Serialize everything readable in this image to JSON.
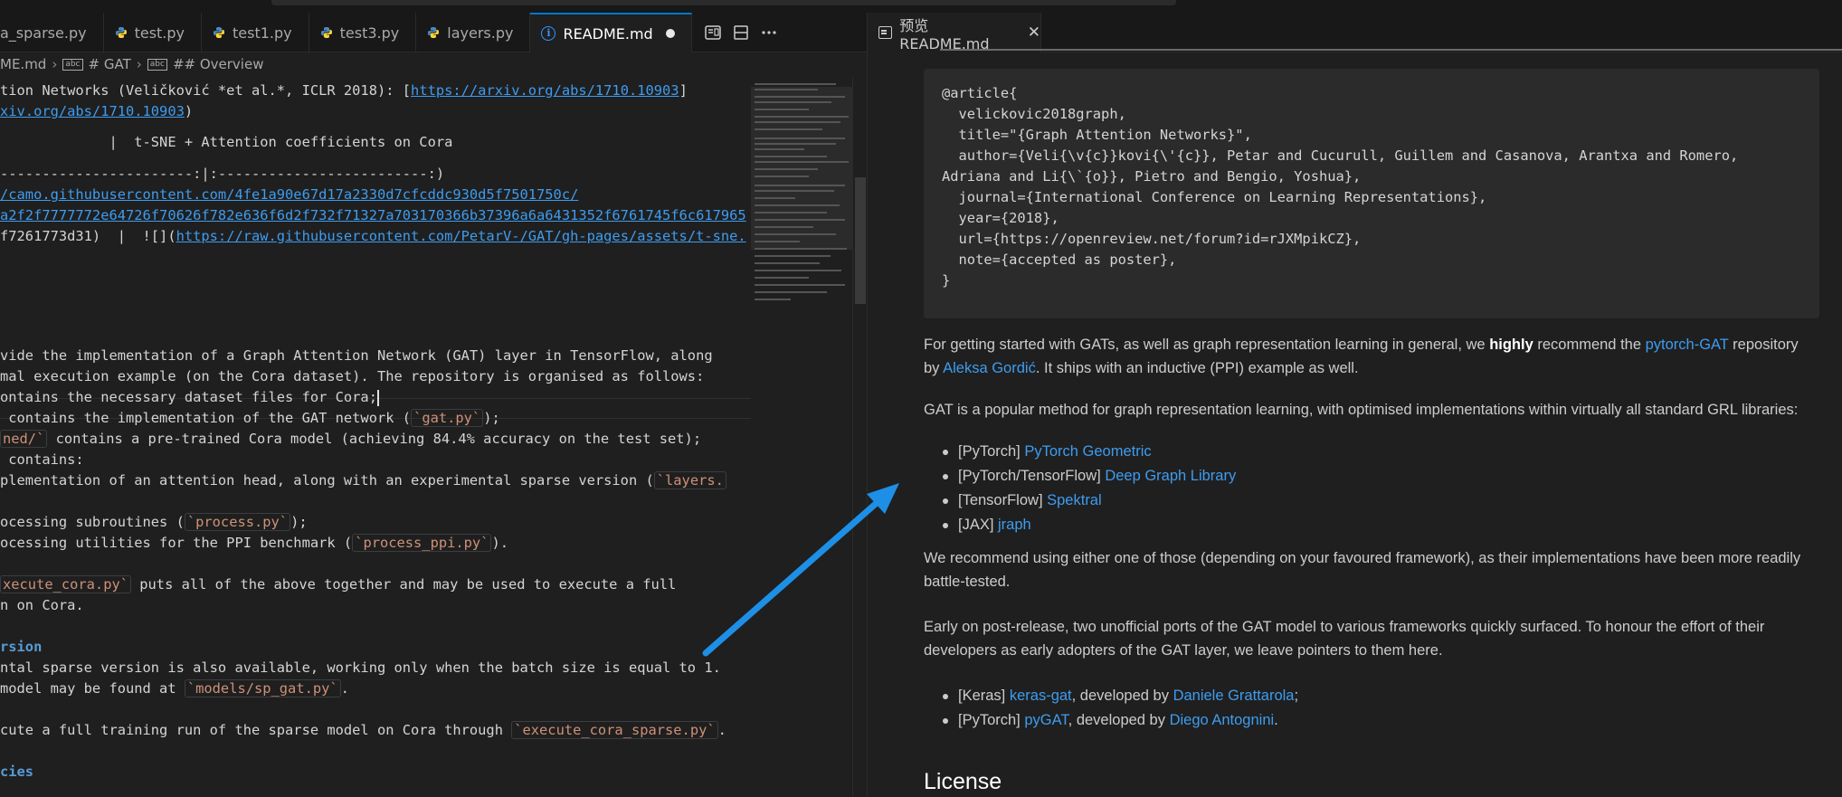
{
  "tabs": [
    {
      "label": "a_sparse.py",
      "icon": "python-icon"
    },
    {
      "label": "test.py",
      "icon": "python-icon"
    },
    {
      "label": "test1.py",
      "icon": "python-icon"
    },
    {
      "label": "test3.py",
      "icon": "python-icon"
    },
    {
      "label": "layers.py",
      "icon": "python-icon"
    },
    {
      "label": "README.md",
      "icon": "info-icon",
      "active": true,
      "dirty": true
    }
  ],
  "breadcrumb": {
    "file": "ME.md",
    "h1": "# GAT",
    "h2": "## Overview"
  },
  "editor_lines": {
    "l1a": "tion Networks (Veličković *et al.*, ICLR 2018): [",
    "l1link": "https://arxiv.org/abs/1710.10903",
    "l1b": "]",
    "l2link": "xiv.org/abs/1710.10903",
    "l2b": ")",
    "l3": "             |  t-SNE + Attention coefficients on Cora",
    "l4": "-----------------------:|:-------------------------:)",
    "l5": "/camo.githubusercontent.com/4fe1a90e67d17a2330d7cfcddc930d5f7501750c/",
    "l6": "a2f2f7777772e64726f70626f782e636f6d2f732f71327a703170366b37396a6a6431352f6761745f6c617965",
    "l7a": "f7261773d31)  |  ![](",
    "l7link": "https://raw.githubusercontent.com/PetarV-/GAT/gh-pages/assets/t-sne.",
    "l8": "vide the implementation of a Graph Attention Network (GAT) layer in TensorFlow, along",
    "l9": "mal execution example (on the Cora dataset). The repository is organised as follows:",
    "l10": "ontains the necessary dataset files for Cora;",
    "l11a": " contains the implementation of the GAT network (",
    "l11code": "`gat.py`",
    "l11b": ");",
    "l12code": "ned/`",
    "l12b": " contains a pre-trained Cora model (achieving 84.4% accuracy on the test set);",
    "l13": " contains:",
    "l14a": "plementation of an attention head, along with an experimental sparse version (",
    "l14code": "`layers.",
    "l15a": "ocessing subroutines (",
    "l15code": "`process.py`",
    "l15b": ");",
    "l16a": "ocessing utilities for the PPI benchmark (",
    "l16code": "`process_ppi.py`",
    "l16b": ").",
    "l17code": "xecute_cora.py`",
    "l17b": " puts all of the above together and may be used to execute a full",
    "l18": "n on Cora.",
    "l19": "rsion",
    "l20": "ntal sparse version is also available, working only when the batch size is equal to 1.",
    "l21a": "model may be found at ",
    "l21code": "`models/sp_gat.py`",
    "l21b": ".",
    "l22a": "cute a full training run of the sparse model on Cora through ",
    "l22code": "`execute_cora_sparse.py`",
    "l22b": ".",
    "l23": "cies"
  },
  "preview": {
    "tab_label": "预览 README.md",
    "bibtex": [
      "@article{",
      "  velickovic2018graph,",
      "  title=\"{Graph Attention Networks}\",",
      "  author={Veli{\\v{c}}kovi{\\'{c}}, Petar and Cucurull, Guillem and Casanova, Arantxa and Romero,",
      "Adriana and Li{\\`{o}}, Pietro and Bengio, Yoshua},",
      "  journal={International Conference on Learning Representations},",
      "  year={2018},",
      "  url={https://openreview.net/forum?id=rJXMpikCZ},",
      "  note={accepted as poster},",
      "}"
    ],
    "p1_a": "For getting started with GATs, as well as graph representation learning in general, we ",
    "p1_bold": "highly",
    "p1_b": " recommend the ",
    "p1_link1": "pytorch-GAT",
    "p1_c": " repository by ",
    "p1_link2": "Aleksa Gordić",
    "p1_d": ". It ships with an inductive (PPI) example as well.",
    "p2": "GAT is a popular method for graph representation learning, with optimised implementations within virtually all standard GRL libraries:",
    "libs": [
      {
        "prefix": "[PyTorch] ",
        "link": "PyTorch Geometric"
      },
      {
        "prefix": "[PyTorch/TensorFlow] ",
        "link": "Deep Graph Library"
      },
      {
        "prefix": "[TensorFlow] ",
        "link": "Spektral"
      },
      {
        "prefix": "[JAX] ",
        "link": "jraph"
      }
    ],
    "p3": "We recommend using either one of those (depending on your favoured framework), as their implementations have been more readily battle-tested.",
    "p4": "Early on post-release, two unofficial ports of the GAT model to various frameworks quickly surfaced. To honour the effort of their developers as early adopters of the GAT layer, we leave pointers to them here.",
    "ports": [
      {
        "prefix": "[Keras] ",
        "link": "keras-gat",
        "mid": ", developed by ",
        "author": "Daniele Grattarola",
        "end": ";"
      },
      {
        "prefix": "[PyTorch] ",
        "link": "pyGAT",
        "mid": ", developed by ",
        "author": "Diego Antognini",
        "end": "."
      }
    ],
    "license_heading": "License"
  },
  "colors": {
    "accent": "#0078d4",
    "link": "#3e9cf0",
    "arrow": "#1e8fe6"
  }
}
